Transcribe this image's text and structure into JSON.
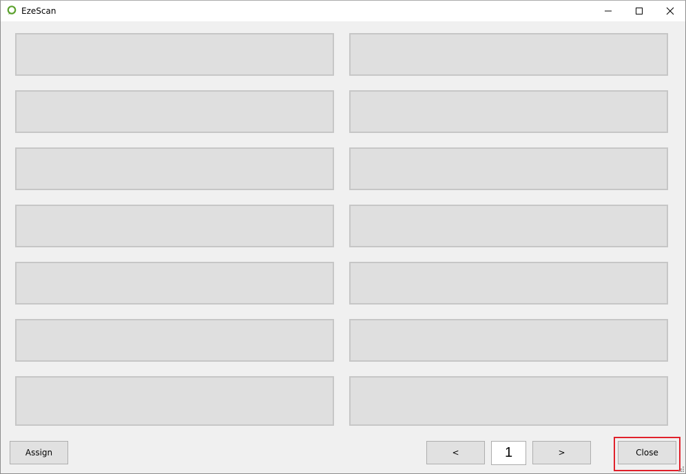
{
  "window": {
    "title": "EzeScan",
    "icon": "ezescan-logo-icon",
    "controls": [
      "minimize-icon",
      "maximize-icon",
      "close-icon"
    ]
  },
  "tiles": [
    {
      "label": ""
    },
    {
      "label": ""
    },
    {
      "label": ""
    },
    {
      "label": ""
    },
    {
      "label": ""
    },
    {
      "label": ""
    },
    {
      "label": ""
    },
    {
      "label": ""
    },
    {
      "label": ""
    },
    {
      "label": ""
    },
    {
      "label": ""
    },
    {
      "label": ""
    },
    {
      "label": ""
    },
    {
      "label": ""
    }
  ],
  "footer": {
    "assign_label": "Assign",
    "prev_label": "<",
    "page_number": "1",
    "next_label": ">",
    "close_label": "Close"
  },
  "colors": {
    "accent_highlight": "#e0202a",
    "icon_green": "#5aa02c"
  }
}
